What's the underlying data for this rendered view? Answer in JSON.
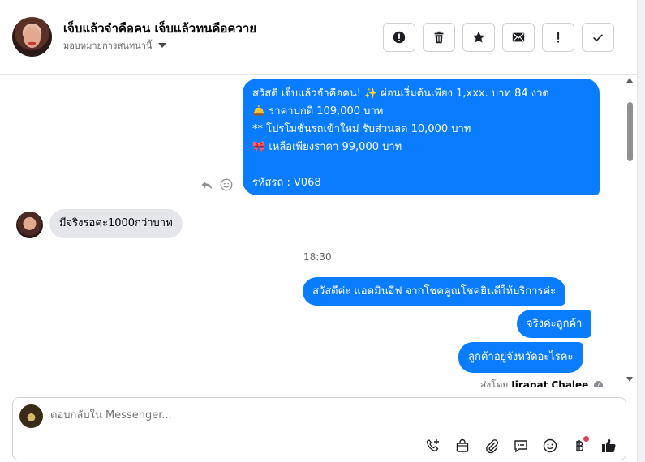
{
  "header": {
    "title": "เจ็บแล้วจำคือคน เจ็บแล้วทนคือควาย",
    "subtitle": "มอบหมายการสนทนานี้",
    "actions": [
      "alert-circle-icon",
      "trash-icon",
      "star-icon",
      "envelope-icon",
      "exclamation-icon",
      "check-icon"
    ]
  },
  "messages": {
    "promo_lines": [
      "สวัสดี เจ็บแล้วจำคือคน! ✨  ผ่อนเริ่มต้นเพียง 1,xxx. บาท 84 งวด",
      "🛎️ ราคาปกติ 109,000 บาท",
      "** โปรโมชั่นรถเข้าใหม่ รับส่วนลด 10,000 บาท",
      "🎀  เหลือเพียงราคา 99,000 บาท",
      "",
      "รหัสรถ : V068"
    ],
    "incoming": "มีจริงรอค่ะ1000กว่าบาท",
    "time": "18:30",
    "out1": "สวัสดีค่ะ แอดมินอีฟ จากโชคคูณโชคยินดีให้บริการค่ะ",
    "out2": "จริงค่ะลูกค้า",
    "out3": "ลูกค้าอยู่จังหวัดอะไรคะ",
    "sent_by_prefix": "ส่งโดย",
    "sent_by_name": "Jirapat Chalee",
    "help_mark": "?"
  },
  "composer": {
    "placeholder": "ตอบกลับใน Messenger...",
    "tools": [
      "phone-add-icon",
      "shopping-bag-icon",
      "paperclip-icon",
      "chat-bubble-icon",
      "emoji-icon",
      "baht-icon",
      "thumbs-up-icon"
    ],
    "baht_badge_color": "#e4405f"
  },
  "colors": {
    "outgoing": "#0a7cff",
    "incoming": "#e4e6eb"
  }
}
